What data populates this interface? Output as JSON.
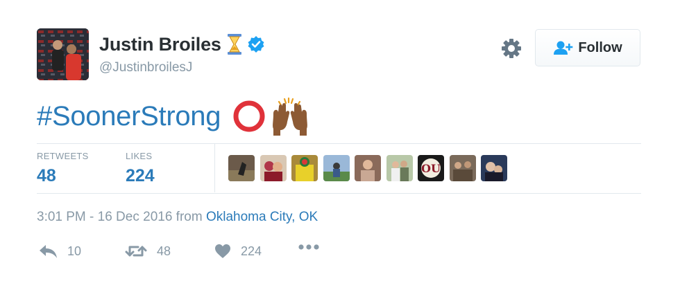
{
  "user": {
    "display_name": "Justin Broiles",
    "handle": "@JustinbroilesJ",
    "avatar_icon": "avatar-photo",
    "status_emoji": "hourglass-emoji",
    "verified_icon": "verified-badge-icon"
  },
  "follow_button": {
    "label": "Follow",
    "icon": "add-user-icon"
  },
  "settings_icon": "gear-icon",
  "tweet": {
    "hashtag": "#SoonerStrong",
    "emojis": [
      "heavy-large-circle-emoji",
      "raising-hands-emoji"
    ]
  },
  "stats": {
    "retweets_label": "RETWEETS",
    "retweets_count": "48",
    "likes_label": "LIKES",
    "likes_count": "224",
    "liker_avatar_count": 9
  },
  "meta": {
    "timestamp": "3:01 PM - 16 Dec 2016",
    "from_text": " from ",
    "location": "Oklahoma City, OK"
  },
  "actions": {
    "reply_count": "10",
    "retweet_count": "48",
    "like_count": "224"
  },
  "colors": {
    "link_blue": "#2b7bb9",
    "secondary_gray": "#8899a6",
    "text_dark": "#292f33",
    "verified_blue": "#1da1f2",
    "border": "#e1e8ed"
  }
}
